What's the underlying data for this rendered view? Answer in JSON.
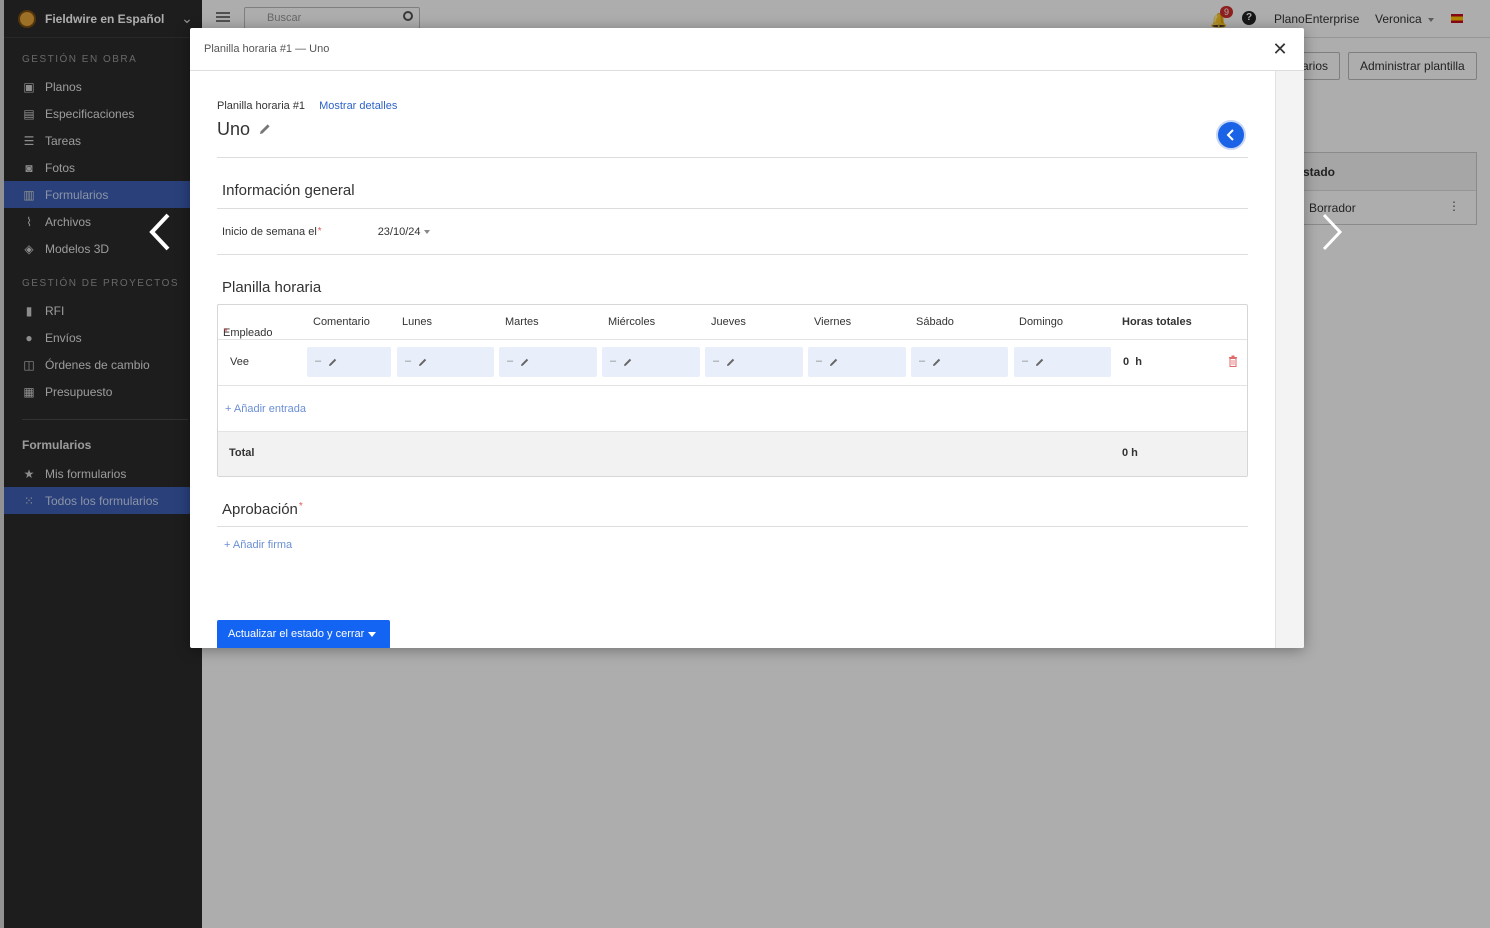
{
  "app": {
    "project_name": "Fieldwire en Español",
    "sections": [
      {
        "title": "GESTIÓN EN OBRA",
        "items": [
          {
            "label": "Planos",
            "icon": "blueprint-icon"
          },
          {
            "label": "Especificaciones",
            "icon": "book-icon"
          },
          {
            "label": "Tareas",
            "icon": "list-icon"
          },
          {
            "label": "Fotos",
            "icon": "camera-icon"
          },
          {
            "label": "Formularios",
            "icon": "clipboard-icon",
            "active": true
          },
          {
            "label": "Archivos",
            "icon": "paperclip-icon"
          },
          {
            "label": "Modelos 3D",
            "icon": "cube-icon"
          }
        ]
      },
      {
        "title": "GESTIÓN DE PROYECTOS",
        "items": [
          {
            "label": "RFI",
            "icon": "document-icon"
          },
          {
            "label": "Envíos",
            "icon": "user-icon"
          },
          {
            "label": "Órdenes de cambio",
            "icon": "money-icon"
          },
          {
            "label": "Presupuesto",
            "icon": "calculator-icon"
          }
        ]
      }
    ],
    "forms_section": {
      "title": "Formularios",
      "items": [
        {
          "label": "Mis formularios",
          "icon": "star-icon"
        },
        {
          "label": "Todos los formularios",
          "icon": "grid-icon",
          "active": true
        }
      ]
    },
    "topbar": {
      "search_placeholder": "Buscar",
      "notification_count": "9",
      "org_name": "PlanoEnterprise",
      "user_name": "Veronica"
    },
    "background": {
      "btn_partial": "arios",
      "btn_manage": "Administrar plantilla",
      "table_header": "stado",
      "table_cell": "Borrador"
    }
  },
  "modal": {
    "header_title": "Planilla horaria #1 — Uno",
    "crumb_title": "Planilla horaria #1",
    "show_details": "Mostrar detalles",
    "doc_title": "Uno",
    "general_info": {
      "title": "Información general",
      "week_start_label": "Inicio de semana el",
      "week_start_value": "23/10/24"
    },
    "timesheet": {
      "title": "Planilla horaria",
      "columns": [
        "Empleado",
        "Comentario",
        "Lunes",
        "Martes",
        "Miércoles",
        "Jueves",
        "Viernes",
        "Sábado",
        "Domingo",
        "Horas totales"
      ],
      "rows": [
        {
          "employee": "Vee",
          "cell_placeholder": "–",
          "total": "0  h"
        }
      ],
      "add_entry": "+ Añadir entrada",
      "total_label": "Total",
      "total_value": "0 h"
    },
    "approval": {
      "title": "Aprobación",
      "add_signature": "+ Añadir firma"
    },
    "primary_button": "Actualizar el estado y cerrar"
  },
  "colors": {
    "accent": "#1464f4",
    "link": "#2e63c8",
    "sidebar_bg": "#2c2c2c",
    "sidebar_active": "#3d5fb5",
    "required": "#e05a5a",
    "cell_bg": "#e9effa"
  }
}
